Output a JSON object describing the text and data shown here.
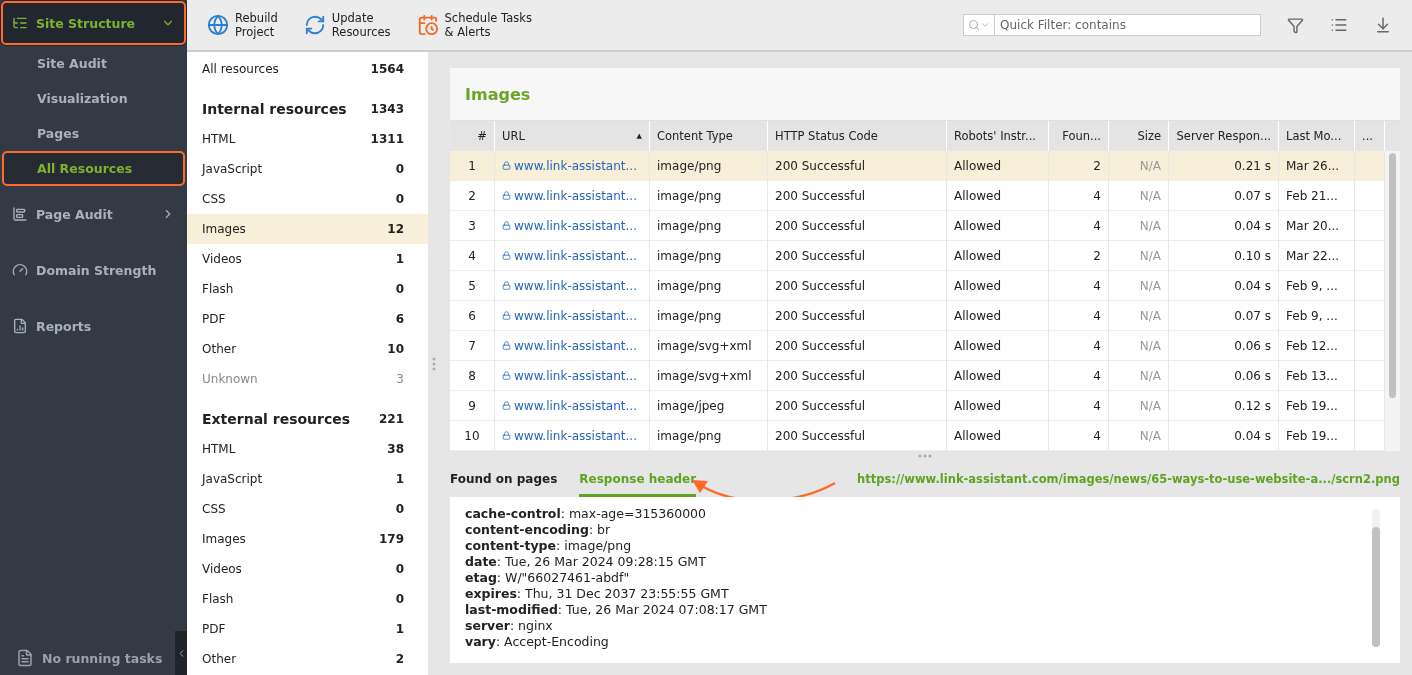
{
  "sidebar": {
    "items": [
      {
        "kind": "section",
        "label": "Site Structure",
        "expanded": true,
        "highlighted": true,
        "selected": true
      },
      {
        "kind": "sub",
        "label": "Site Audit",
        "selected": false,
        "highlighted": false
      },
      {
        "kind": "sub",
        "label": "Visualization",
        "selected": false,
        "highlighted": false
      },
      {
        "kind": "sub",
        "label": "Pages",
        "selected": false,
        "highlighted": false
      },
      {
        "kind": "sub",
        "label": "All Resources",
        "selected": true,
        "highlighted": true
      },
      {
        "kind": "section",
        "label": "Page Audit",
        "expanded": false,
        "highlighted": false,
        "selected": false
      },
      {
        "kind": "section",
        "label": "Domain Strength",
        "highlighted": false,
        "selected": false
      },
      {
        "kind": "section",
        "label": "Reports",
        "highlighted": false,
        "selected": false
      }
    ],
    "status": "No running tasks"
  },
  "toolbar": {
    "buttons": [
      {
        "kind": "rebuild",
        "label": "Rebuild\nProject"
      },
      {
        "kind": "update",
        "label": "Update\nResources"
      },
      {
        "kind": "schedule",
        "label": "Schedule Tasks\n& Alerts"
      }
    ],
    "filter": {
      "placeholder": "Quick Filter: contains"
    }
  },
  "resources": [
    {
      "kind": "row",
      "label": "All resources",
      "count": "1564",
      "selected": false,
      "muted": false
    },
    {
      "kind": "heading",
      "label": "Internal resources",
      "count": "1343"
    },
    {
      "kind": "row",
      "label": "HTML",
      "count": "1311",
      "selected": false,
      "muted": false
    },
    {
      "kind": "row",
      "label": "JavaScript",
      "count": "0",
      "selected": false,
      "muted": false
    },
    {
      "kind": "row",
      "label": "CSS",
      "count": "0",
      "selected": false,
      "muted": false
    },
    {
      "kind": "row",
      "label": "Images",
      "count": "12",
      "selected": true,
      "muted": false
    },
    {
      "kind": "row",
      "label": "Videos",
      "count": "1",
      "selected": false,
      "muted": false
    },
    {
      "kind": "row",
      "label": "Flash",
      "count": "0",
      "selected": false,
      "muted": false
    },
    {
      "kind": "row",
      "label": "PDF",
      "count": "6",
      "selected": false,
      "muted": false
    },
    {
      "kind": "row",
      "label": "Other",
      "count": "10",
      "selected": false,
      "muted": false
    },
    {
      "kind": "row",
      "label": "Unknown",
      "count": "3",
      "selected": false,
      "muted": true
    },
    {
      "kind": "heading",
      "label": "External resources",
      "count": "221"
    },
    {
      "kind": "row",
      "label": "HTML",
      "count": "38",
      "selected": false,
      "muted": false
    },
    {
      "kind": "row",
      "label": "JavaScript",
      "count": "1",
      "selected": false,
      "muted": false
    },
    {
      "kind": "row",
      "label": "CSS",
      "count": "0",
      "selected": false,
      "muted": false
    },
    {
      "kind": "row",
      "label": "Images",
      "count": "179",
      "selected": false,
      "muted": false
    },
    {
      "kind": "row",
      "label": "Videos",
      "count": "0",
      "selected": false,
      "muted": false
    },
    {
      "kind": "row",
      "label": "Flash",
      "count": "0",
      "selected": false,
      "muted": false
    },
    {
      "kind": "row",
      "label": "PDF",
      "count": "1",
      "selected": false,
      "muted": false
    },
    {
      "kind": "row",
      "label": "Other",
      "count": "2",
      "selected": false,
      "muted": false
    }
  ],
  "panel": {
    "title": "Images",
    "table": {
      "columns": [
        {
          "label": "#"
        },
        {
          "label": "URL",
          "sort_mark": "▲"
        },
        {
          "label": "Content Type"
        },
        {
          "label": "HTTP Status Code"
        },
        {
          "label": "Robots' Instr..."
        },
        {
          "label": "Foun..."
        },
        {
          "label": "Size"
        },
        {
          "label": "Server Respon..."
        },
        {
          "label": "Last Mo..."
        },
        {
          "label": "..."
        }
      ],
      "rows": [
        {
          "selected": true,
          "cells": [
            "1",
            "www.link-assistant...",
            "image/png",
            "200 Successful",
            "Allowed",
            "2",
            "N/A",
            "0.21 s",
            "Mar 26..."
          ]
        },
        {
          "selected": false,
          "cells": [
            "2",
            "www.link-assistant...",
            "image/png",
            "200 Successful",
            "Allowed",
            "4",
            "N/A",
            "0.07 s",
            "Feb 21..."
          ]
        },
        {
          "selected": false,
          "cells": [
            "3",
            "www.link-assistant...",
            "image/png",
            "200 Successful",
            "Allowed",
            "4",
            "N/A",
            "0.04 s",
            "Mar 20..."
          ]
        },
        {
          "selected": false,
          "cells": [
            "4",
            "www.link-assistant...",
            "image/png",
            "200 Successful",
            "Allowed",
            "2",
            "N/A",
            "0.10 s",
            "Mar 22..."
          ]
        },
        {
          "selected": false,
          "cells": [
            "5",
            "www.link-assistant...",
            "image/png",
            "200 Successful",
            "Allowed",
            "4",
            "N/A",
            "0.04 s",
            "Feb 9, ..."
          ]
        },
        {
          "selected": false,
          "cells": [
            "6",
            "www.link-assistant...",
            "image/png",
            "200 Successful",
            "Allowed",
            "4",
            "N/A",
            "0.07 s",
            "Feb 9, ..."
          ]
        },
        {
          "selected": false,
          "cells": [
            "7",
            "www.link-assistant...",
            "image/svg+xml",
            "200 Successful",
            "Allowed",
            "4",
            "N/A",
            "0.06 s",
            "Feb 12..."
          ]
        },
        {
          "selected": false,
          "cells": [
            "8",
            "www.link-assistant...",
            "image/svg+xml",
            "200 Successful",
            "Allowed",
            "4",
            "N/A",
            "0.06 s",
            "Feb 13..."
          ]
        },
        {
          "selected": false,
          "cells": [
            "9",
            "www.link-assistant...",
            "image/jpeg",
            "200 Successful",
            "Allowed",
            "4",
            "N/A",
            "0.12 s",
            "Feb 19..."
          ]
        },
        {
          "selected": false,
          "cells": [
            "10",
            "www.link-assistant...",
            "image/png",
            "200 Successful",
            "Allowed",
            "4",
            "N/A",
            "0.04 s",
            "Feb 19..."
          ]
        }
      ]
    }
  },
  "details": {
    "tabs": [
      {
        "label": "Found on pages",
        "selected": false
      },
      {
        "label": "Response header",
        "selected": true
      }
    ],
    "url": "https://www.link-assistant.com/images/news/65-ways-to-use-website-a.../scrn2.png",
    "headers": [
      "**cache-control**: max-age=315360000",
      "**content-encoding**: br",
      "**content-type**: image/png",
      "**date**: Tue, 26 Mar 2024 09:28:15 GMT",
      "**etag**: W/\"66027461-abdf\"",
      "**expires**: Thu, 31 Dec 2037 23:55:55 GMT",
      "**last-modified**: Tue, 26 Mar 2024 07:08:17 GMT",
      "**server**: nginx",
      "**vary**: Accept-Encoding"
    ]
  }
}
